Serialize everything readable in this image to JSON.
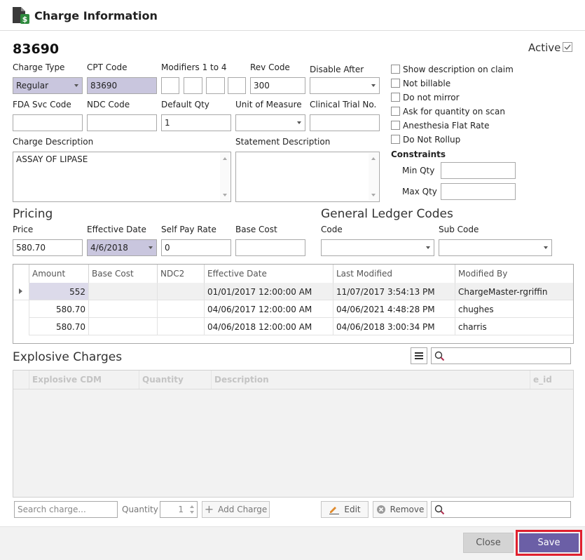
{
  "window": {
    "title": "Charge Information"
  },
  "header": {
    "charge_number": "83690",
    "active_label": "Active",
    "active_checked": true
  },
  "form": {
    "charge_type": {
      "label": "Charge Type",
      "value": "Regular"
    },
    "cpt_code": {
      "label": "CPT Code",
      "value": "83690"
    },
    "modifiers": {
      "label": "Modifiers 1 to 4",
      "values": [
        "",
        "",
        "",
        ""
      ]
    },
    "rev_code": {
      "label": "Rev Code",
      "value": "300"
    },
    "disable_after": {
      "label": "Disable After",
      "value": ""
    },
    "fda_svc_code": {
      "label": "FDA Svc Code",
      "value": ""
    },
    "ndc_code": {
      "label": "NDC Code",
      "value": ""
    },
    "default_qty": {
      "label": "Default Qty",
      "value": "1"
    },
    "unit_of_measure": {
      "label": "Unit of Measure",
      "value": ""
    },
    "clinical_trial_no": {
      "label": "Clinical Trial No.",
      "value": ""
    },
    "charge_description": {
      "label": "Charge Description",
      "value": "ASSAY OF LIPASE"
    },
    "statement_description": {
      "label": "Statement Description",
      "value": ""
    }
  },
  "options": [
    {
      "label": "Show description on claim",
      "checked": false
    },
    {
      "label": "Not billable",
      "checked": false
    },
    {
      "label": "Do not mirror",
      "checked": false
    },
    {
      "label": "Ask for quantity on scan",
      "checked": false
    },
    {
      "label": "Anesthesia Flat Rate",
      "checked": false
    },
    {
      "label": "Do Not Rollup",
      "checked": false
    }
  ],
  "constraints": {
    "heading": "Constraints",
    "min_qty_label": "Min Qty",
    "min_qty": "",
    "max_qty_label": "Max Qty",
    "max_qty": ""
  },
  "pricing": {
    "heading": "Pricing",
    "price_label": "Price",
    "price": "580.70",
    "effective_date_label": "Effective Date",
    "effective_date": "4/6/2018",
    "self_pay_rate_label": "Self Pay Rate",
    "self_pay_rate": "0",
    "base_cost_label": "Base Cost",
    "base_cost": ""
  },
  "gl_codes": {
    "heading": "General Ledger Codes",
    "code_label": "Code",
    "code": "",
    "sub_code_label": "Sub Code",
    "sub_code": ""
  },
  "price_grid": {
    "columns": [
      "Amount",
      "Base Cost",
      "NDC2",
      "Effective Date",
      "Last Modified",
      "Modified By"
    ],
    "rows": [
      [
        "552",
        "",
        "",
        "01/01/2017 12:00:00 AM",
        "11/07/2017 3:54:13 PM",
        "ChargeMaster-rgriffin"
      ],
      [
        "580.70",
        "",
        "",
        "04/06/2017 12:00:00 AM",
        "04/06/2021 4:48:28 PM",
        "chughes"
      ],
      [
        "580.70",
        "",
        "",
        "04/06/2018 12:00:00 AM",
        "04/06/2018 3:00:34 PM",
        "charris"
      ]
    ]
  },
  "explosive": {
    "heading": "Explosive Charges",
    "search_value": "",
    "columns": [
      "Explosive CDM",
      "Quantity",
      "Description",
      "e_id"
    ],
    "search_charge_placeholder": "Search charge...",
    "quantity_label": "Quantity",
    "quantity_value": "1",
    "add_charge_label": "Add Charge",
    "edit_label": "Edit",
    "remove_label": "Remove",
    "bottom_search_value": ""
  },
  "footer": {
    "close_label": "Close",
    "save_label": "Save"
  },
  "colors": {
    "accent": "#6b5fa6",
    "highlight_border": "#e0202e",
    "shaded_field": "#c9c6de"
  }
}
